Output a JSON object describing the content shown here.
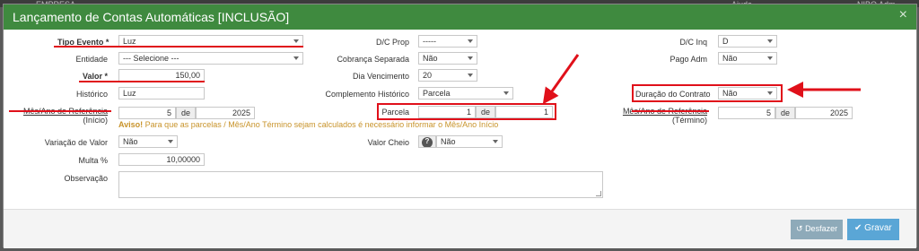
{
  "window": {
    "title": "Lançamento de Contas Automáticas [INCLUSÃO]",
    "close_glyph": "×"
  },
  "background": {
    "ghost_left": "EMPRESA",
    "ghost_mid": "Ajuda",
    "ghost_right": "NIBO Adm"
  },
  "form": {
    "tipo_evento": {
      "label": "Tipo Evento *",
      "value": "Luz"
    },
    "entidade": {
      "label": "Entidade",
      "value": "--- Selecione ---"
    },
    "valor": {
      "label": "Valor *",
      "value": "150,00"
    },
    "historico": {
      "label": "Histórico",
      "value": "Luz"
    },
    "mes_ano_ref_inicio": {
      "label_line1": "Mês/Ano de Referência",
      "label_line2": "(Início)",
      "month": "5",
      "sep": "de",
      "year": "2025"
    },
    "aviso": {
      "prefix": "Aviso!",
      "text": " Para que as parcelas / Mês/Ano Término sejam calculados é necessário informar o Mês/Ano Início"
    },
    "variacao_valor": {
      "label": "Variação de Valor",
      "value": "Não"
    },
    "multa": {
      "label": "Multa %",
      "value": "10,00000"
    },
    "observacao": {
      "label": "Observação",
      "value": ""
    },
    "dc_prop": {
      "label": "D/C Prop",
      "value": "-----"
    },
    "cobranca_separada": {
      "label": "Cobrança Separada",
      "value": "Não"
    },
    "dia_vencimento": {
      "label": "Dia Vencimento",
      "value": "20"
    },
    "complemento_historico": {
      "label": "Complemento Histórico",
      "value": "Parcela"
    },
    "parcela": {
      "label": "Parcela",
      "current": "1",
      "sep": "de",
      "total": "1"
    },
    "valor_cheio": {
      "label": "Valor Cheio",
      "help_icon": "?",
      "value": "Não"
    },
    "dc_inq": {
      "label": "D/C Inq",
      "value": "D"
    },
    "pago_adm": {
      "label": "Pago Adm",
      "value": "Não"
    },
    "duracao_contrato": {
      "label": "Duração do Contrato",
      "value": "Não"
    },
    "mes_ano_ref_termino": {
      "label_line1": "Mês/Ano de Referência",
      "label_line2": "(Término)",
      "month": "5",
      "sep": "de",
      "year": "2025"
    }
  },
  "footer": {
    "undo_label": "Desfazer",
    "save_label": "Gravar",
    "undo_icon": "↺",
    "save_icon": "✔"
  },
  "colors": {
    "header": "#3f8a3f",
    "annotation_red": "#e0101a",
    "warning": "#c8932a",
    "save_button": "#5aa6d6",
    "undo_button": "#8eaab9"
  }
}
